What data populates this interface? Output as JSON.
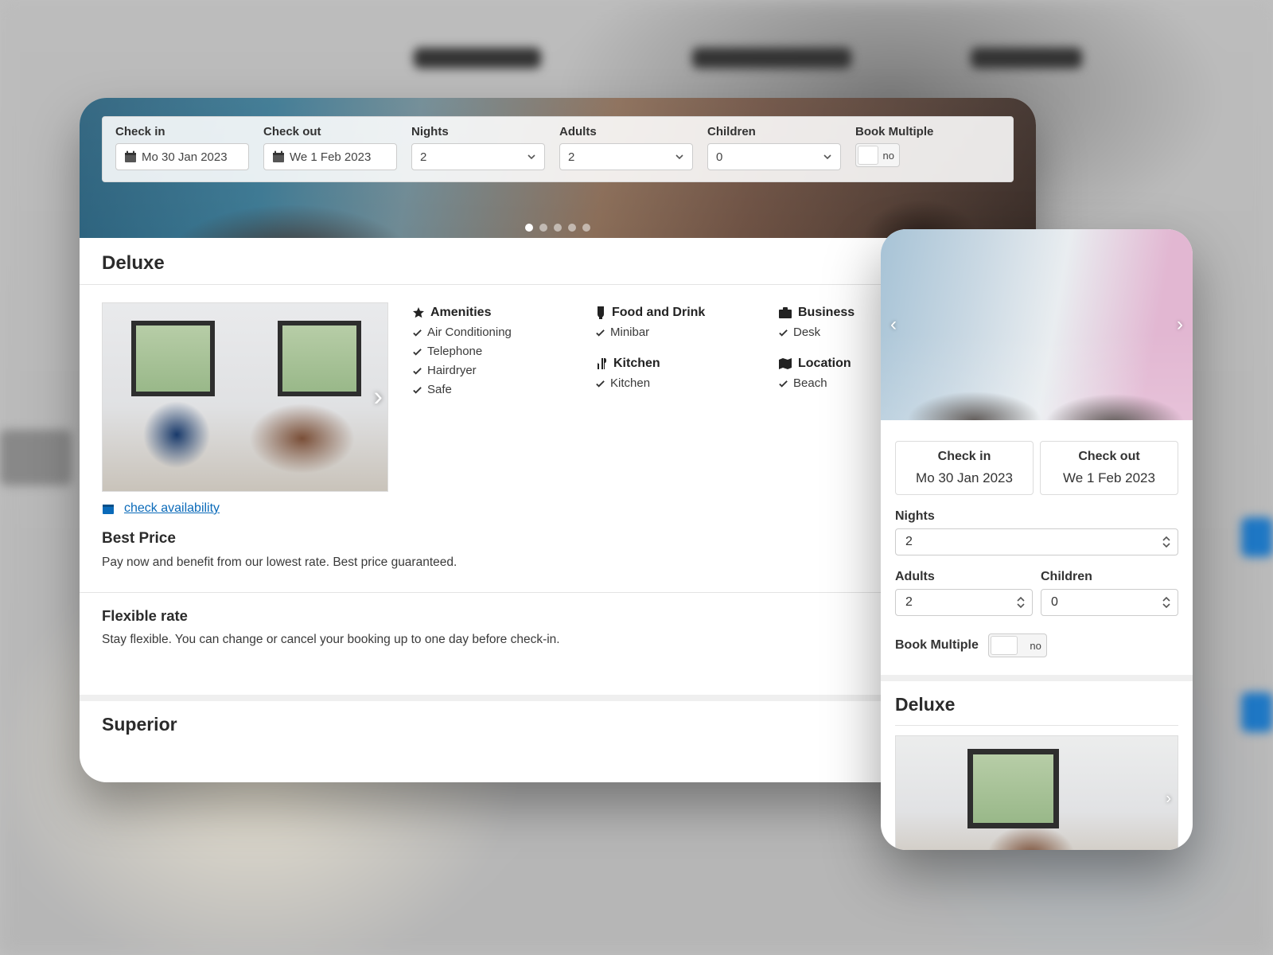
{
  "search": {
    "checkInLabel": "Check in",
    "checkOutLabel": "Check out",
    "nightsLabel": "Nights",
    "adultsLabel": "Adults",
    "childrenLabel": "Children",
    "bookMultipleLabel": "Book Multiple",
    "checkInValue": "Mo 30 Jan 2023",
    "checkOutValue": "We 1 Feb 2023",
    "nightsValue": "2",
    "adultsValue": "2",
    "childrenValue": "0",
    "bookMultipleValue": "no"
  },
  "room": {
    "title": "Deluxe",
    "checkAvailability": "check availability",
    "amenities": {
      "heading": "Amenities",
      "items": [
        "Air Conditioning",
        "Telephone",
        "Hairdryer",
        "Safe"
      ]
    },
    "foodDrink": {
      "heading": "Food and Drink",
      "items": [
        "Minibar"
      ]
    },
    "kitchen": {
      "heading": "Kitchen",
      "items": [
        "Kitchen"
      ]
    },
    "business": {
      "heading": "Business",
      "items": [
        "Desk"
      ]
    },
    "location": {
      "heading": "Location",
      "items": [
        "Beach"
      ]
    }
  },
  "rate1": {
    "title": "Best Price",
    "desc": "Pay now and benefit from our lowest rate. Best price guaranteed."
  },
  "rate2": {
    "title": "Flexible rate",
    "desc": "Stay flexible. You can change or cancel your booking up to one day before check-in."
  },
  "room2": {
    "title": "Superior"
  },
  "mobile": {
    "checkInLabel": "Check in",
    "checkOutLabel": "Check out",
    "checkInValue": "Mo 30 Jan 2023",
    "checkOutValue": "We 1 Feb 2023",
    "nightsLabel": "Nights",
    "nightsValue": "2",
    "adultsLabel": "Adults",
    "adultsValue": "2",
    "childrenLabel": "Children",
    "childrenValue": "0",
    "bookMultipleLabel": "Book Multiple",
    "bookMultipleValue": "no",
    "roomTitle": "Deluxe"
  }
}
